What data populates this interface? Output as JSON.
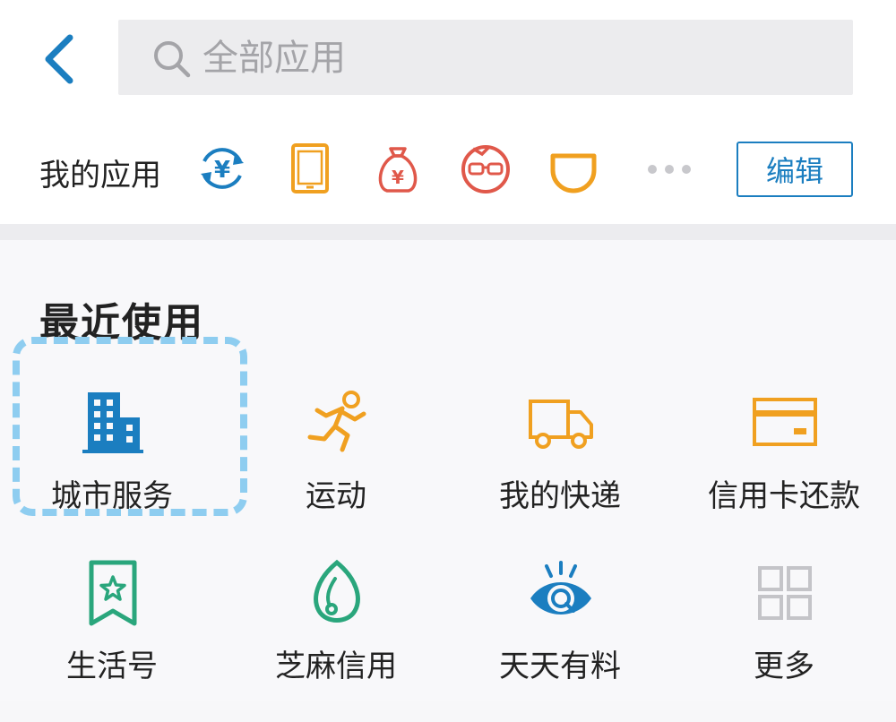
{
  "header": {
    "search_placeholder": "全部应用"
  },
  "my_apps": {
    "label": "我的应用",
    "edit_label": "编辑",
    "icons": [
      "exchange-yuan-icon",
      "tablet-icon",
      "money-bag-icon",
      "glasses-face-icon",
      "didi-icon"
    ]
  },
  "recent": {
    "title": "最近使用",
    "tiles": [
      {
        "label": "城市服务",
        "icon": "city-building-icon",
        "color": "#1b7ec0"
      },
      {
        "label": "运动",
        "icon": "running-man-icon",
        "color": "#f0a020"
      },
      {
        "label": "我的快递",
        "icon": "delivery-truck-icon",
        "color": "#f0a020"
      },
      {
        "label": "信用卡还款",
        "icon": "credit-card-icon",
        "color": "#f0a020"
      },
      {
        "label": "生活号",
        "icon": "bookmark-star-icon",
        "color": "#2aa67c"
      },
      {
        "label": "芝麻信用",
        "icon": "sesame-seed-icon",
        "color": "#2aa67c"
      },
      {
        "label": "天天有料",
        "icon": "eye-icon",
        "color": "#1b7ec0"
      },
      {
        "label": "更多",
        "icon": "grid-more-icon",
        "color": "#c4c4c8"
      }
    ]
  },
  "colors": {
    "accent_blue": "#1b7ec0",
    "orange": "#f0a020",
    "red": "#e0584a",
    "green": "#2aa67c",
    "highlight": "#8ecdf0"
  }
}
